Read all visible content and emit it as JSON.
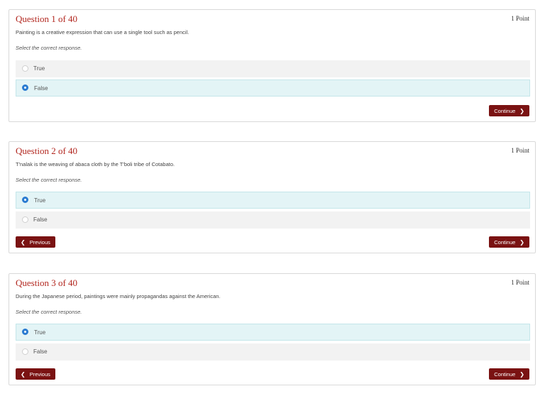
{
  "questions": [
    {
      "title": "Question 1 of 40",
      "points": "1 Point",
      "prompt": "Painting is a creative expression that can use a single tool such as pencil.",
      "instruction": "Select the correct response.",
      "options": [
        {
          "label": "True",
          "selected": false
        },
        {
          "label": "False",
          "selected": true
        }
      ],
      "continue_label": "Continue",
      "chevron_right": "❯"
    },
    {
      "title": "Question 2 of 40",
      "points": "1 Point",
      "prompt": "T'nalak is the weaving of abaca cloth by the T'boli tribe of Cotabato.",
      "instruction": "Select the correct response.",
      "options": [
        {
          "label": "True",
          "selected": true
        },
        {
          "label": "False",
          "selected": false
        }
      ],
      "previous_label": "Previous",
      "continue_label": "Continue",
      "chevron_left": "❮",
      "chevron_right": "❯"
    },
    {
      "title": "Question 3 of 40",
      "points": "1 Point",
      "prompt": "During the Japanese period, paintings were mainly propagandas against the American.",
      "instruction": "Select the correct response.",
      "options": [
        {
          "label": "True",
          "selected": true
        },
        {
          "label": "False",
          "selected": false
        }
      ],
      "previous_label": "Previous",
      "continue_label": "Continue",
      "chevron_left": "❮",
      "chevron_right": "❯"
    }
  ],
  "colors": {
    "title": "#b2271f",
    "button": "#7a1212",
    "selected_bg": "#e3f4f6",
    "radio_selected": "#2a7bd1",
    "option_bg": "#f2f2f2"
  }
}
